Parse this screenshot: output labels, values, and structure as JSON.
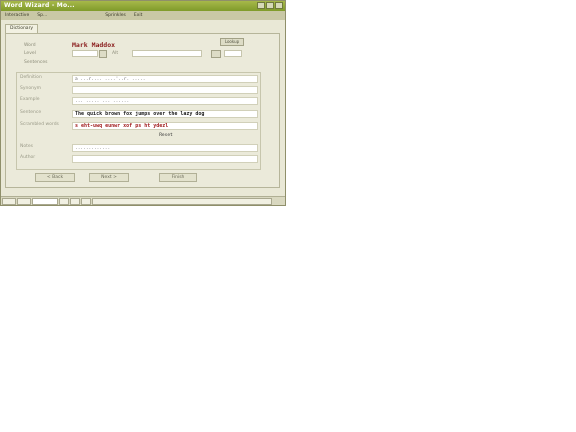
{
  "window": {
    "title": "Word Wizard - Mo..."
  },
  "menubar": {
    "items": [
      "Interactive",
      "Sp...",
      "Sprinkles",
      "Exit"
    ]
  },
  "tab": {
    "label": "Dictionary"
  },
  "header": {
    "word_label": "Word",
    "word_value": "Mark Maddox",
    "level_label": "Level",
    "lookup_button": "Lookup",
    "alt_label": "Alt",
    "extra_label": "Sentences"
  },
  "fields": [
    {
      "label": "Definition",
      "value": "a ...r....  ....'..r.  ....."
    },
    {
      "label": "Synonym",
      "value": ""
    },
    {
      "label": "Example",
      "value": "... ..... ... ......"
    },
    {
      "label": "Sentence",
      "value": "The quick brown fox jumps over the lazy dog",
      "style": "strong"
    },
    {
      "label": "Scrambled words",
      "value": "s  eht-uwq   eunwr  xof   ps   ht  ydezl",
      "style": "red"
    },
    {
      "label": "",
      "value": "Reset"
    },
    {
      "label": "Notes",
      "value": "............."
    },
    {
      "label": "Author",
      "value": ""
    }
  ],
  "buttons": {
    "back": "< Back",
    "next": "Next >",
    "finish": "Finish"
  },
  "statusbar": {
    "segments": [
      "",
      "",
      "",
      "",
      "",
      "",
      ""
    ]
  }
}
